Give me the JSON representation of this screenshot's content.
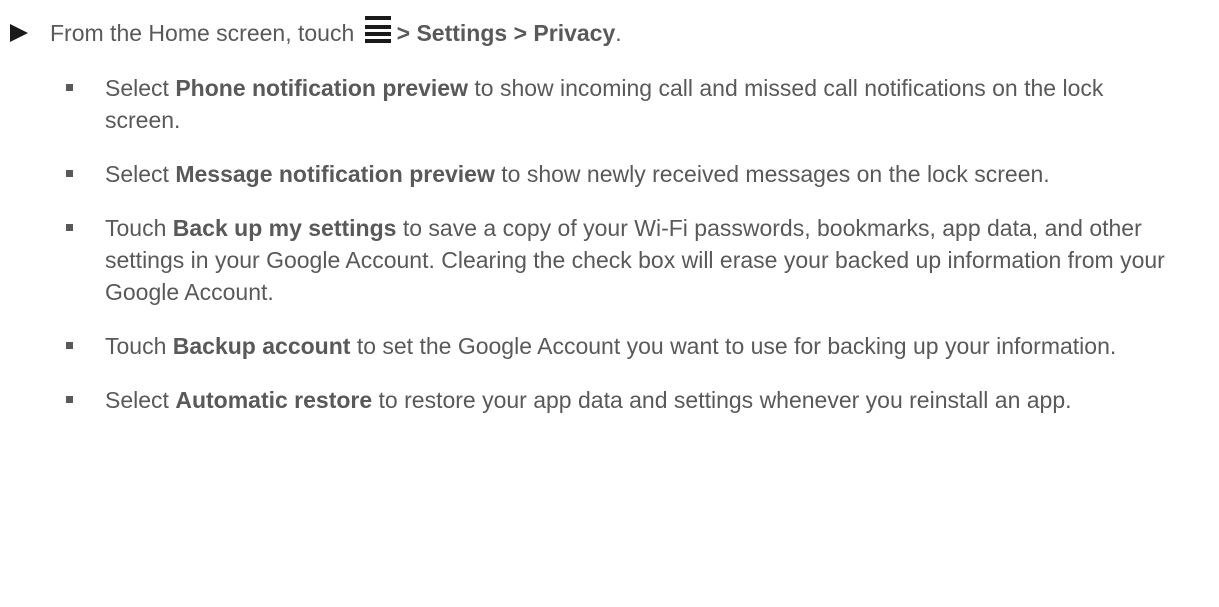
{
  "instruction": {
    "prefix": "From the Home screen, touch",
    "menu_icon": "menu-icon",
    "sep1": ">",
    "settings": "Settings",
    "sep2": ">",
    "privacy": "Privacy",
    "suffix": "."
  },
  "items": [
    {
      "verb": "Select",
      "term": "Phone notification preview",
      "text": "to show incoming call and missed call notifications on the lock screen."
    },
    {
      "verb": "Select",
      "term": "Message notification preview",
      "text": "to show newly received messages on the lock screen."
    },
    {
      "verb": "Touch",
      "term": "Back up my settings",
      "text": "to save a copy of your Wi-Fi passwords, bookmarks, app data, and other settings in your Google Account. Clearing the check box will erase your backed up information from your Google Account."
    },
    {
      "verb": "Touch",
      "term": "Backup account",
      "text": "to set the Google Account you want to use for backing up your information."
    },
    {
      "verb": "Select",
      "term": "Automatic restore",
      "text": "to restore your app data and settings whenever you reinstall an app."
    }
  ],
  "colors": {
    "text": "#595959",
    "icon": "#1a1a1a"
  }
}
